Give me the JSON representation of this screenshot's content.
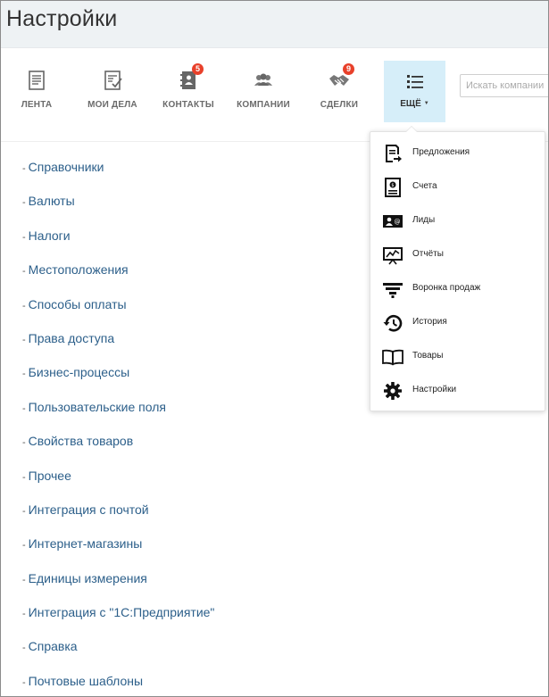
{
  "page": {
    "title": "Настройки"
  },
  "toolbar": {
    "items": [
      {
        "label": "ЛЕНТА",
        "icon": "feed-icon"
      },
      {
        "label": "МОИ ДЕЛА",
        "icon": "tasks-icon"
      },
      {
        "label": "КОНТАКТЫ",
        "icon": "contacts-icon",
        "badge": "5"
      },
      {
        "label": "КОМПАНИИ",
        "icon": "companies-icon"
      },
      {
        "label": "СДЕЛКИ",
        "icon": "deals-icon",
        "badge": "9"
      },
      {
        "label": "ЕЩЁ",
        "icon": "list-icon"
      }
    ],
    "search_placeholder": "Искать компании"
  },
  "settings_list": [
    "Справочники",
    "Валюты",
    "Налоги",
    "Местоположения",
    "Способы оплаты",
    "Права доступа",
    "Бизнес-процессы",
    "Пользовательские поля",
    "Свойства товаров",
    "Прочее",
    "Интеграция с почтой",
    "Интернет-магазины",
    "Единицы измерения",
    "Интеграция с \"1С:Предприятие\"",
    "Справка",
    "Почтовые шаблоны"
  ],
  "list_dash": "-",
  "dropdown": {
    "items": [
      {
        "label": "Предложения",
        "icon": "offer-icon"
      },
      {
        "label": "Счета",
        "icon": "invoice-icon"
      },
      {
        "label": "Лиды",
        "icon": "leads-icon"
      },
      {
        "label": "Отчёты",
        "icon": "reports-icon"
      },
      {
        "label": "Воронка продаж",
        "icon": "funnel-icon"
      },
      {
        "label": "История",
        "icon": "history-icon"
      },
      {
        "label": "Товары",
        "icon": "products-icon"
      },
      {
        "label": "Настройки",
        "icon": "settings-icon"
      }
    ]
  },
  "colors": {
    "accent_bg": "#d6eef9",
    "link": "#2c5f8a",
    "badge": "#e8402a",
    "title_bar": "#eef2f4"
  }
}
